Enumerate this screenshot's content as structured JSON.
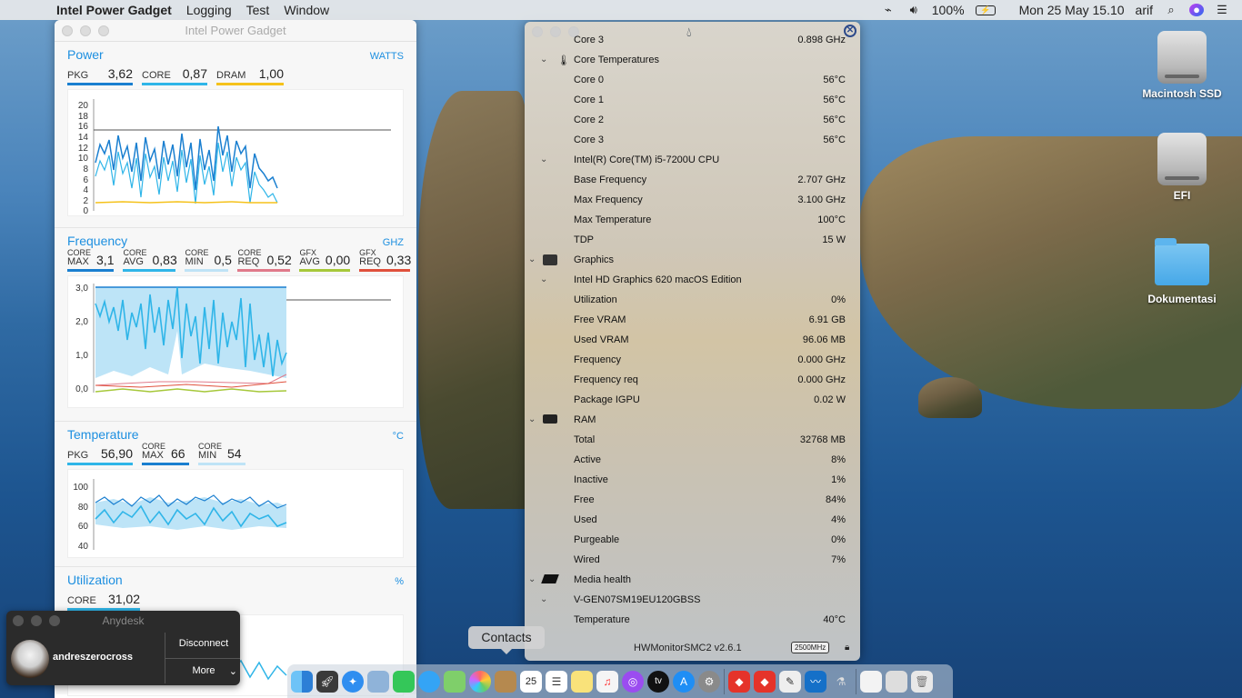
{
  "menubar": {
    "app_name": "Intel Power Gadget",
    "menus": [
      "Logging",
      "Test",
      "Window"
    ],
    "battery_percent": "100%",
    "datetime": "Mon 25 May  15.10",
    "user": "arif"
  },
  "ipg": {
    "window_title": "Intel Power Gadget",
    "power": {
      "title": "Power",
      "unit": "WATTS",
      "metrics": [
        {
          "label": "PKG",
          "value": "3,62",
          "color": "#1a7fd0"
        },
        {
          "label": "CORE",
          "value": "0,87",
          "color": "#2fb5e8"
        },
        {
          "label": "DRAM",
          "value": "1,00",
          "color": "#f5c21b"
        }
      ],
      "y_ticks": [
        "20",
        "18",
        "16",
        "14",
        "12",
        "10",
        "8",
        "6",
        "4",
        "2",
        "0"
      ]
    },
    "frequency": {
      "title": "Frequency",
      "unit": "GHZ",
      "metrics": [
        {
          "top": "CORE",
          "bottom": "MAX",
          "value": "3,1",
          "color": "#1a7fd0"
        },
        {
          "top": "CORE",
          "bottom": "AVG",
          "value": "0,83",
          "color": "#2fb5e8"
        },
        {
          "top": "CORE",
          "bottom": "MIN",
          "value": "0,5",
          "color": "#bfe3f6"
        },
        {
          "top": "CORE",
          "bottom": "REQ",
          "value": "0,52",
          "color": "#e07a8a"
        },
        {
          "top": "GFX",
          "bottom": "AVG",
          "value": "0,00",
          "color": "#a6c83a"
        },
        {
          "top": "GFX",
          "bottom": "REQ",
          "value": "0,33",
          "color": "#e0503c"
        }
      ],
      "y_ticks": [
        "3,0",
        "2,0",
        "1,0",
        "0,0"
      ]
    },
    "temperature": {
      "title": "Temperature",
      "unit": "°C",
      "metrics": [
        {
          "label": "PKG",
          "value": "56,90",
          "color": "#2fb5e8"
        },
        {
          "top": "CORE",
          "bottom": "MAX",
          "value": "66",
          "color": "#1a7fd0"
        },
        {
          "top": "CORE",
          "bottom": "MIN",
          "value": "54",
          "color": "#bfe3f6"
        }
      ],
      "y_ticks": [
        "100",
        "80",
        "60",
        "40"
      ]
    },
    "utilization": {
      "title": "Utilization",
      "unit": "%",
      "metrics": [
        {
          "label": "CORE",
          "value": "31,02",
          "color": "#2fb5e8"
        }
      ]
    }
  },
  "hwm": {
    "rows": [
      {
        "kind": "item",
        "label": "Core 3",
        "value": "0.898 GHz"
      },
      {
        "kind": "group",
        "label": "Core Temperatures",
        "icon": "thermometer-icon",
        "value": ""
      },
      {
        "kind": "item",
        "label": "Core 0",
        "value": "56°C"
      },
      {
        "kind": "item",
        "label": "Core 1",
        "value": "56°C"
      },
      {
        "kind": "item",
        "label": "Core 2",
        "value": "56°C"
      },
      {
        "kind": "item",
        "label": "Core 3",
        "value": "56°C"
      },
      {
        "kind": "sub",
        "label": "Intel(R) Core(TM) i5-7200U CPU",
        "value": ""
      },
      {
        "kind": "item",
        "label": "Base Frequency",
        "value": "2.707 GHz"
      },
      {
        "kind": "item",
        "label": "Max Frequency",
        "value": "3.100 GHz"
      },
      {
        "kind": "item",
        "label": "Max Temperature",
        "value": "100°C"
      },
      {
        "kind": "item",
        "label": "TDP",
        "value": "15 W"
      },
      {
        "kind": "top",
        "label": "Graphics",
        "icon": "gpu-icon",
        "value": ""
      },
      {
        "kind": "sub",
        "label": "Intel HD Graphics 620 macOS Edition",
        "value": ""
      },
      {
        "kind": "item",
        "label": "Utilization",
        "value": "0%"
      },
      {
        "kind": "item",
        "label": "Free VRAM",
        "value": "6.91 GB"
      },
      {
        "kind": "item",
        "label": "Used VRAM",
        "value": "96.06 MB"
      },
      {
        "kind": "item",
        "label": "Frequency",
        "value": "0.000 GHz"
      },
      {
        "kind": "item",
        "label": "Frequency req",
        "value": "0.000 GHz"
      },
      {
        "kind": "item",
        "label": "Package IGPU",
        "value": "0.02 W"
      },
      {
        "kind": "top",
        "label": "RAM",
        "icon": "ram-icon",
        "value": ""
      },
      {
        "kind": "item",
        "label": "Total",
        "value": "32768 MB"
      },
      {
        "kind": "item",
        "label": "Active",
        "value": "8%"
      },
      {
        "kind": "item",
        "label": "Inactive",
        "value": "1%"
      },
      {
        "kind": "item",
        "label": "Free",
        "value": "84%"
      },
      {
        "kind": "item",
        "label": "Used",
        "value": "4%"
      },
      {
        "kind": "item",
        "label": "Purgeable",
        "value": "0%"
      },
      {
        "kind": "item",
        "label": "Wired",
        "value": "7%"
      },
      {
        "kind": "top",
        "label": "Media health",
        "icon": "disk-icon",
        "value": ""
      },
      {
        "kind": "sub",
        "label": "V-GEN07SM19EU120GBSS",
        "value": ""
      },
      {
        "kind": "item",
        "label": "Temperature",
        "value": "40°C"
      }
    ],
    "footer_version": "HWMonitorSMC2 v2.6.1",
    "footer_badge": "2500MHz"
  },
  "desktop": {
    "icons": [
      "Macintosh SSD",
      "EFI",
      "Dokumentasi"
    ]
  },
  "anydesk": {
    "title": "Anydesk",
    "user": "andreszerocross",
    "disconnect": "Disconnect",
    "more": "More"
  },
  "dock": {
    "tooltip": "Contacts",
    "calendar_day": "25"
  }
}
